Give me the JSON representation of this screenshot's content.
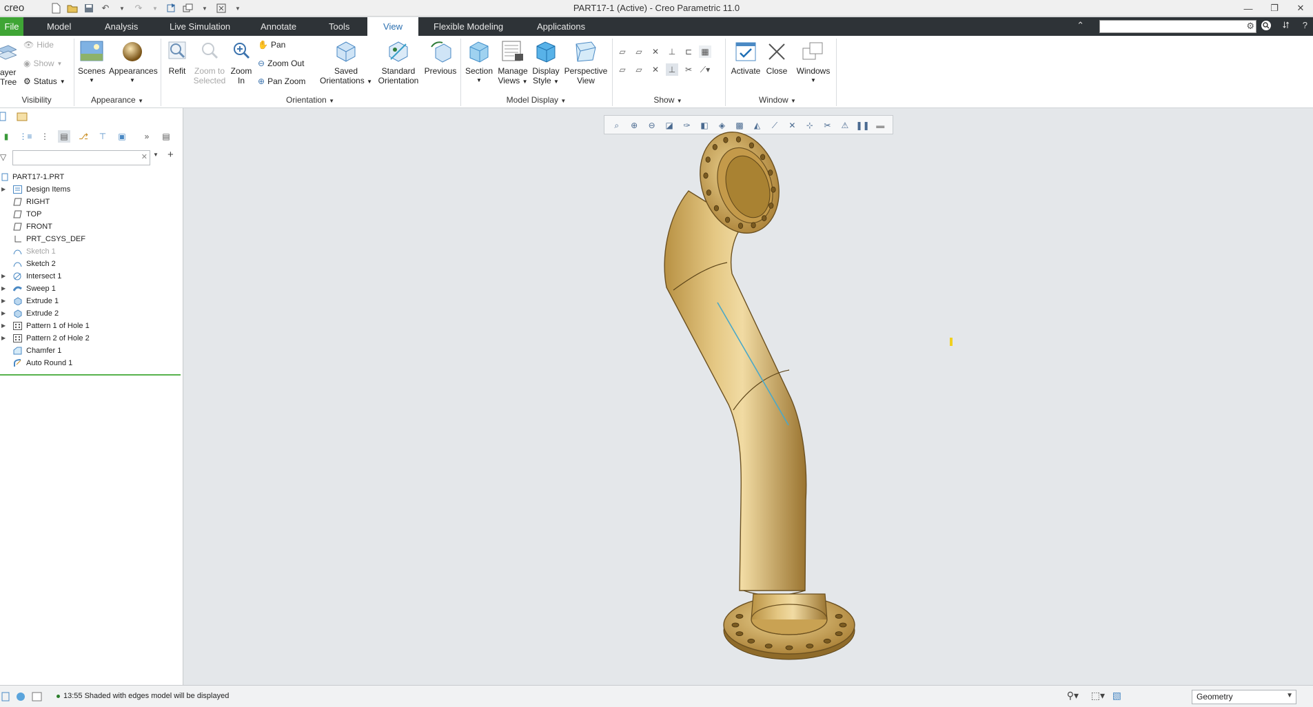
{
  "app": {
    "logo": "creo",
    "window_title": "PART17-1 (Active) - Creo Parametric 11.0"
  },
  "tabs": [
    {
      "label": "File"
    },
    {
      "label": "Model"
    },
    {
      "label": "Analysis"
    },
    {
      "label": "Live Simulation"
    },
    {
      "label": "Annotate"
    },
    {
      "label": "Tools"
    },
    {
      "label": "View"
    },
    {
      "label": "Flexible Modeling"
    },
    {
      "label": "Applications"
    }
  ],
  "ribbon": {
    "visibility": {
      "label": "Visibility",
      "layer_tree": "ayer\nTree",
      "hide": "Hide",
      "show": "Show",
      "status": "Status"
    },
    "appearance": {
      "label": "Appearance",
      "scenes": "Scenes",
      "appearances": "Appearances"
    },
    "orientation": {
      "label": "Orientation",
      "refit": "Refit",
      "zoom_to_selected": "Zoom to Selected",
      "zoom_in": "Zoom In",
      "pan": "Pan",
      "zoom_out": "Zoom Out",
      "pan_zoom": "Pan Zoom",
      "saved_orientations": "Saved Orientations",
      "standard_orientation": "Standard Orientation",
      "previous": "Previous"
    },
    "model_display": {
      "label": "Model Display",
      "section": "Section",
      "manage_views": "Manage Views",
      "display_style": "Display Style",
      "perspective_view": "Perspective View"
    },
    "show": {
      "label": "Show"
    },
    "window": {
      "label": "Window",
      "activate": "Activate",
      "close": "Close",
      "windows": "Windows"
    }
  },
  "model_tree": {
    "root": "PART17-1.PRT",
    "items": [
      {
        "label": "Design Items",
        "expandable": true,
        "icon": "design-items-icon"
      },
      {
        "label": "RIGHT",
        "expandable": false,
        "icon": "datum-plane-icon"
      },
      {
        "label": "TOP",
        "expandable": false,
        "icon": "datum-plane-icon"
      },
      {
        "label": "FRONT",
        "expandable": false,
        "icon": "datum-plane-icon"
      },
      {
        "label": "PRT_CSYS_DEF",
        "expandable": false,
        "icon": "csys-icon"
      },
      {
        "label": "Sketch 1",
        "expandable": false,
        "icon": "sketch-icon",
        "dim": true
      },
      {
        "label": "Sketch 2",
        "expandable": false,
        "icon": "sketch-icon"
      },
      {
        "label": "Intersect 1",
        "expandable": true,
        "icon": "intersect-icon"
      },
      {
        "label": "Sweep 1",
        "expandable": true,
        "icon": "sweep-icon"
      },
      {
        "label": "Extrude 1",
        "expandable": true,
        "icon": "extrude-icon"
      },
      {
        "label": "Extrude 2",
        "expandable": true,
        "icon": "extrude-icon"
      },
      {
        "label": "Pattern 1 of Hole 1",
        "expandable": true,
        "icon": "pattern-icon"
      },
      {
        "label": "Pattern 2 of Hole 2",
        "expandable": true,
        "icon": "pattern-icon"
      },
      {
        "label": "Chamfer 1",
        "expandable": false,
        "icon": "chamfer-icon"
      },
      {
        "label": "Auto Round 1",
        "expandable": false,
        "icon": "round-icon"
      }
    ]
  },
  "status": {
    "message": "13:55  Shaded with edges model will be displayed",
    "filter_value": "Geometry"
  },
  "colors": {
    "accent_file": "#3fa535",
    "tabbar": "#2e3337",
    "active_tab_text": "#2a6fb0",
    "model": "#d8b566"
  }
}
